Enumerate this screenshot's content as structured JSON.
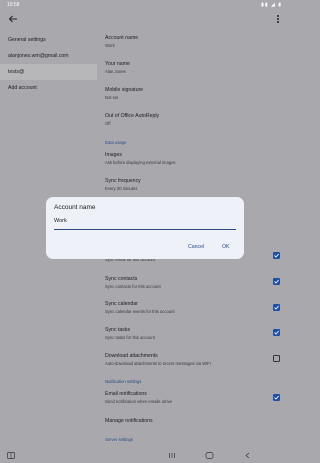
{
  "status_bar": {
    "time": "10:58",
    "icons": "▮▮ ◢ ▮"
  },
  "top_bar": {
    "back_icon": "back-arrow-icon",
    "menu_icon": "more-vert-icon"
  },
  "sidebar": {
    "items": [
      {
        "label": "General settings",
        "selected": false
      },
      {
        "label": "alanjones.wm@gmail.com",
        "selected": false
      },
      {
        "label": "tests@",
        "selected": true
      },
      {
        "label": "Add account",
        "selected": false
      }
    ]
  },
  "settings": {
    "account_name": {
      "title": "Account name",
      "value": "Work"
    },
    "your_name": {
      "title": "Your name",
      "value": "Alan Jones"
    },
    "mobile_signature": {
      "title": "Mobile signature",
      "value": "Not set"
    },
    "out_of_office": {
      "title": "Out of Office AutoReply",
      "value": "Off"
    },
    "data_usage_header": "Data usage",
    "images": {
      "title": "Images",
      "value": "Ask before displaying external images"
    },
    "sync_frequency": {
      "title": "Sync frequency",
      "value": "Every 30 minutes"
    },
    "sync_email": {
      "sub": "Sync email for this account",
      "checked": true
    },
    "sync_contacts": {
      "title": "Sync contacts",
      "sub": "Sync contacts for this account",
      "checked": true
    },
    "sync_calendar": {
      "title": "Sync calendar",
      "sub": "Sync calendar events for this account",
      "checked": true
    },
    "sync_tasks": {
      "title": "Sync tasks",
      "sub": "Sync tasks for this account",
      "checked": true
    },
    "download_attachments": {
      "title": "Download attachments",
      "sub": "Auto-download attachments to recent messages via WiFi",
      "checked": false
    },
    "notification_header": "Notification settings",
    "email_notifications": {
      "title": "Email notifications",
      "sub": "Send notification when emails arrive",
      "checked": true
    },
    "manage_notifications": {
      "title": "Manage notifications"
    },
    "server_header": "Server settings"
  },
  "dialog": {
    "title": "Account name",
    "input_value": "Work",
    "cancel_label": "Cancel",
    "ok_label": "OK"
  },
  "colors": {
    "accent": "#1e4fa3",
    "link": "#2a4a86",
    "scrim": "#a9a9ad",
    "dialog_bg": "#eef1f7"
  }
}
